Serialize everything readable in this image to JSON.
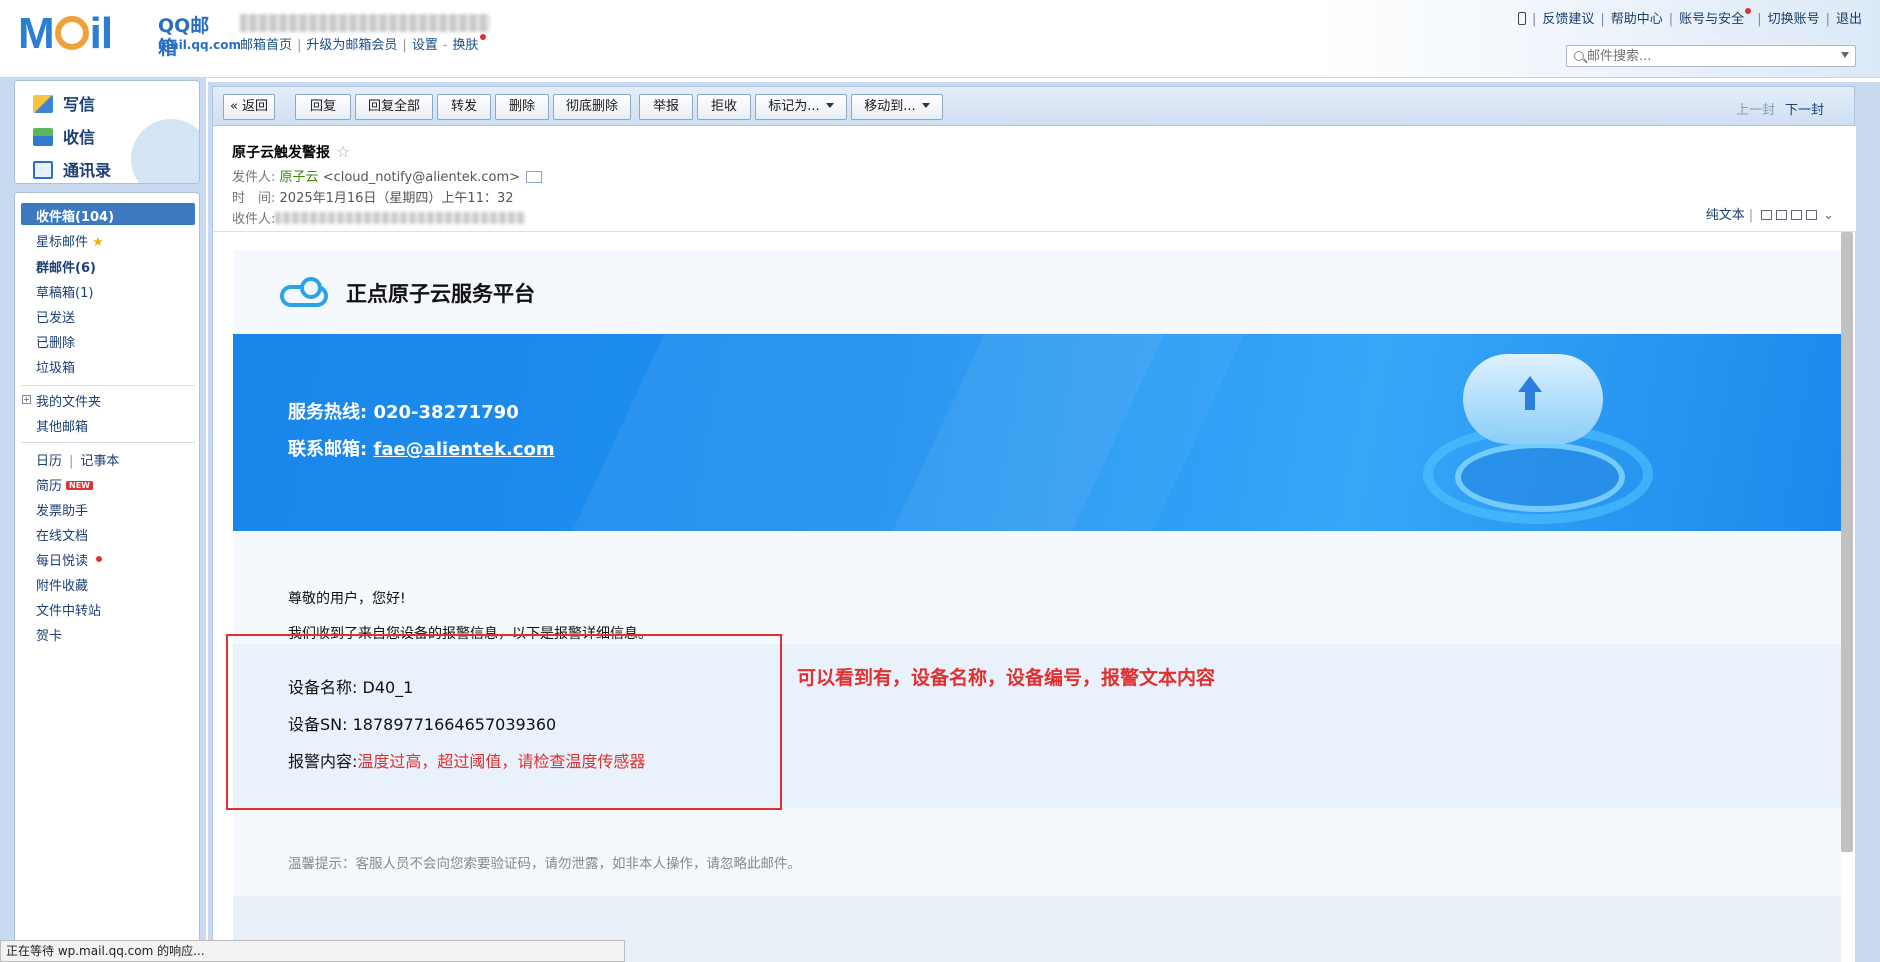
{
  "header": {
    "logo_text": "MOil",
    "brand": "QQ邮箱",
    "site": "mail.qq.com",
    "nav": [
      "邮箱首页",
      "升级为邮箱会员",
      "设置",
      "换肤"
    ],
    "links": [
      "反馈建议",
      "帮助中心",
      "账号与安全",
      "切换账号",
      "退出"
    ],
    "search_placeholder": "邮件搜索..."
  },
  "sidebar": {
    "compose": "写信",
    "inbox": "收信",
    "contacts": "通讯录",
    "folders": {
      "inbox": "收件箱(104)",
      "starred": "星标邮件",
      "group": "群邮件(6)",
      "drafts": "草稿箱(1)",
      "sent": "已发送",
      "deleted": "已删除",
      "spam": "垃圾箱",
      "my_folders": "我的文件夹",
      "other": "其他邮箱",
      "calendar": "日历",
      "notes": "记事本",
      "resume": "简历",
      "resume_badge": "NEW",
      "invoice": "发票助手",
      "docs": "在线文档",
      "daily": "每日悦读",
      "attachments": "附件收藏",
      "transfer": "文件中转站",
      "cards": "贺卡"
    }
  },
  "toolbar": {
    "back": "« 返回",
    "reply": "回复",
    "reply_all": "回复全部",
    "forward": "转发",
    "delete": "删除",
    "purge": "彻底删除",
    "report": "举报",
    "reject": "拒收",
    "mark_as": "标记为...",
    "move_to": "移动到...",
    "prev": "上一封",
    "next": "下一封"
  },
  "mail": {
    "subject": "原子云触发警报",
    "from_label": "发件人:",
    "from_name": "原子云",
    "from_addr": "<cloud_notify@alientek.com>",
    "time_label": "时　间:",
    "time_value": "2025年1月16日（星期四）上午11：32",
    "to_label": "收件人:",
    "plain_text": "纯文本"
  },
  "body": {
    "platform_title": "正点原子云服务平台",
    "hotline_label": "服务热线:",
    "hotline": "020-38271790",
    "email_label": "联系邮箱:",
    "email": "fae@alientek.com",
    "greeting": "尊敬的用户，您好!",
    "intro": "我们收到了来自您设备的报警信息，以下是报警详细信息。",
    "device_name_label": "设备名称:",
    "device_name": "D40_1",
    "device_sn_label": "设备SN:",
    "device_sn": "18789771664657039360",
    "alarm_label": "报警内容:",
    "alarm_content": "温度过高，超过阈值，请检查温度传感器",
    "tip": "温馨提示：客服人员不会向您索要验证码，请勿泄露，如非本人操作，请忽略此邮件。"
  },
  "annotation": "可以看到有，设备名称，设备编号，报警文本内容",
  "status_bar": "正在等待 wp.mail.qq.com 的响应..."
}
